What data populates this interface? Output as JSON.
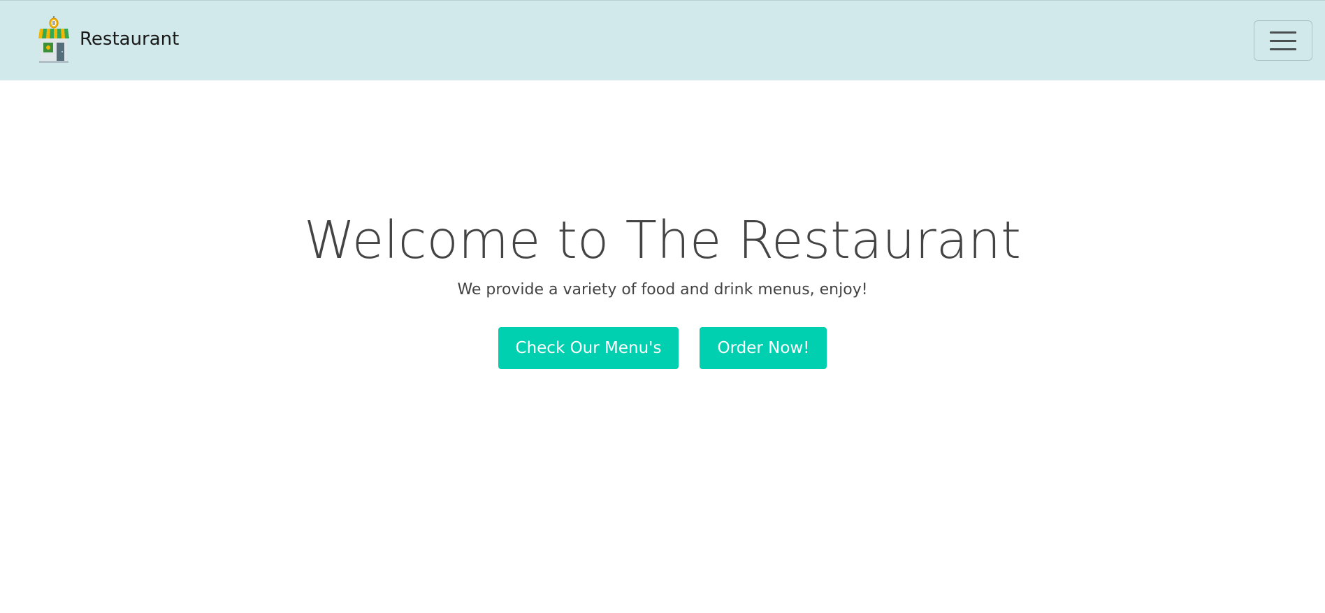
{
  "navbar": {
    "brand_name": "Restaurant",
    "brand_logo_icon": "restaurant-storefront-icon",
    "toggler_icon": "hamburger-menu-icon",
    "background_color": "#d1e9ea"
  },
  "hero": {
    "title": "Welcome to The Restaurant",
    "subtitle": "We provide a variety of food and drink menus, enjoy!",
    "buttons": {
      "menu_label": "Check Our Menu's",
      "order_label": "Order Now!"
    },
    "accent_color": "#00cfb0",
    "text_color": "#444444"
  }
}
